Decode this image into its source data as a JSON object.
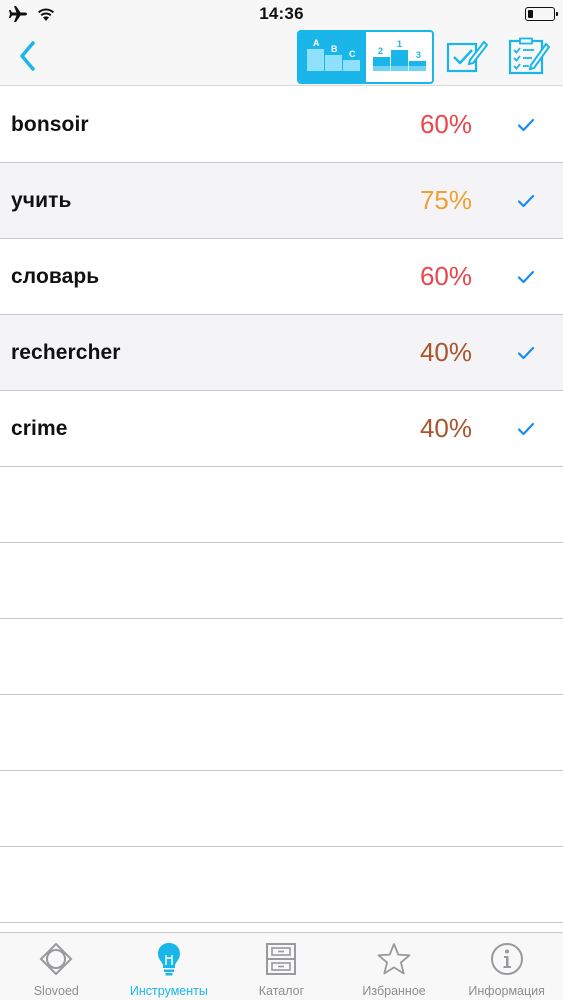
{
  "status_bar": {
    "time": "14:36",
    "icons": [
      "airplane-icon",
      "wifi-icon",
      "battery-icon"
    ]
  },
  "nav": {
    "back_icon": "chevron-left-icon",
    "sort_segments": [
      {
        "name": "sort-alphabetical",
        "glyph_letters": [
          "A",
          "B",
          "C"
        ],
        "selected": true
      },
      {
        "name": "sort-by-rank",
        "glyph_digits": [
          "2",
          "1",
          "3"
        ],
        "selected": false
      }
    ],
    "tools": [
      "edit-icon",
      "checklist-edit-icon"
    ],
    "accent_color": "#1bb6e9"
  },
  "words": [
    {
      "word": "bonsoir",
      "percent": "60%",
      "color": "#e8474c",
      "checked": true
    },
    {
      "word": "учить",
      "percent": "75%",
      "color": "#f0a030",
      "checked": true
    },
    {
      "word": "словарь",
      "percent": "60%",
      "color": "#e8474c",
      "checked": true
    },
    {
      "word": "rechercher",
      "percent": "40%",
      "color": "#a8552c",
      "checked": true
    },
    {
      "word": "crime",
      "percent": "40%",
      "color": "#a8552c",
      "checked": true
    }
  ],
  "check_color": "#1a8cf0",
  "tabs": [
    {
      "label": "Slovoed",
      "icon": "slovoed-logo-icon",
      "active": false
    },
    {
      "label": "Инструменты",
      "icon": "lightbulb-icon",
      "active": true
    },
    {
      "label": "Каталог",
      "icon": "cabinet-icon",
      "active": false
    },
    {
      "label": "Избранное",
      "icon": "star-icon",
      "active": false
    },
    {
      "label": "Информация",
      "icon": "info-icon",
      "active": false
    }
  ]
}
